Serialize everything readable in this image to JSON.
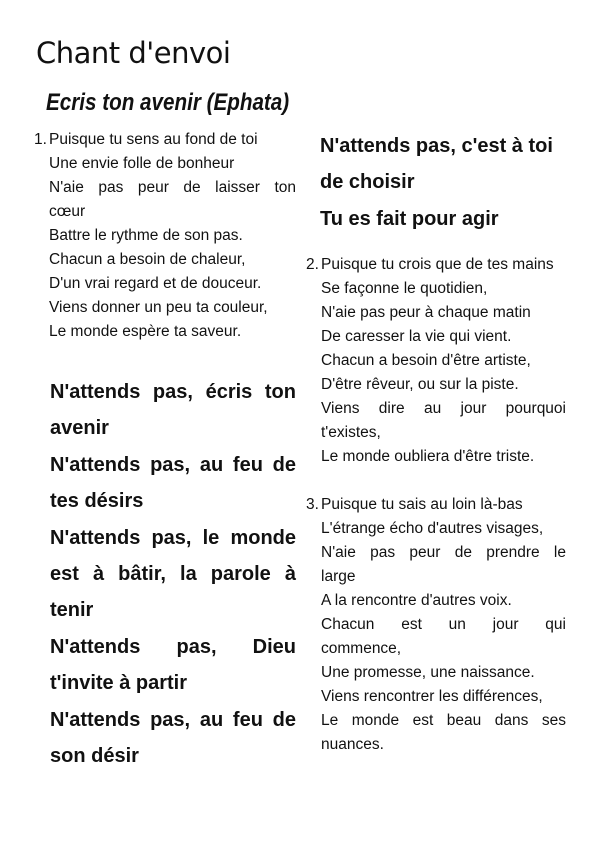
{
  "header": {
    "page_title": "Chant d'envoi",
    "song_title": "Ecris ton avenir (Ephata)"
  },
  "verse1": {
    "number": "1.",
    "lines": [
      "Puisque tu sens au fond de toi",
      "Une envie folle de bonheur",
      "N'aie pas peur de laisser ton",
      "cœur",
      "Battre le rythme de son pas.",
      "Chacun a besoin de chaleur,",
      "D'un vrai regard et de douceur.",
      "Viens donner un peu ta couleur,",
      "Le monde espère ta saveur."
    ]
  },
  "refrain": {
    "lines": [
      "N'attends pas, écris ton",
      "avenir",
      "N'attends pas, au feu de",
      "tes désirs",
      "N'attends pas, le monde",
      "est à bâtir, la parole à",
      "tenir",
      "N'attends pas, Dieu",
      "t'invite à partir",
      "N'attends pas, au feu de",
      "son désir"
    ],
    "continuation_lines": [
      "N'attends pas, c'est à toi",
      "de choisir",
      "Tu es fait pour agir"
    ]
  },
  "verse2": {
    "number": "2.",
    "lines": [
      "Puisque tu crois que de tes mains",
      "Se façonne le quotidien,",
      "N'aie pas peur à chaque matin",
      "De caresser la vie qui vient.",
      "Chacun a besoin d'être artiste,",
      "D'être rêveur, ou sur la piste.",
      "Viens dire au jour pourquoi",
      "t'existes,",
      "Le monde oubliera d'être triste."
    ]
  },
  "verse3": {
    "number": "3.",
    "lines": [
      "Puisque tu sais au loin là-bas",
      "L'étrange écho d'autres visages,",
      "N'aie pas peur de prendre le",
      "large",
      "A la rencontre d'autres voix.",
      "Chacun est un jour qui",
      "commence,",
      "Une promesse, une naissance.",
      "Viens rencontrer les différences,",
      "Le monde est beau dans ses",
      "nuances."
    ]
  }
}
